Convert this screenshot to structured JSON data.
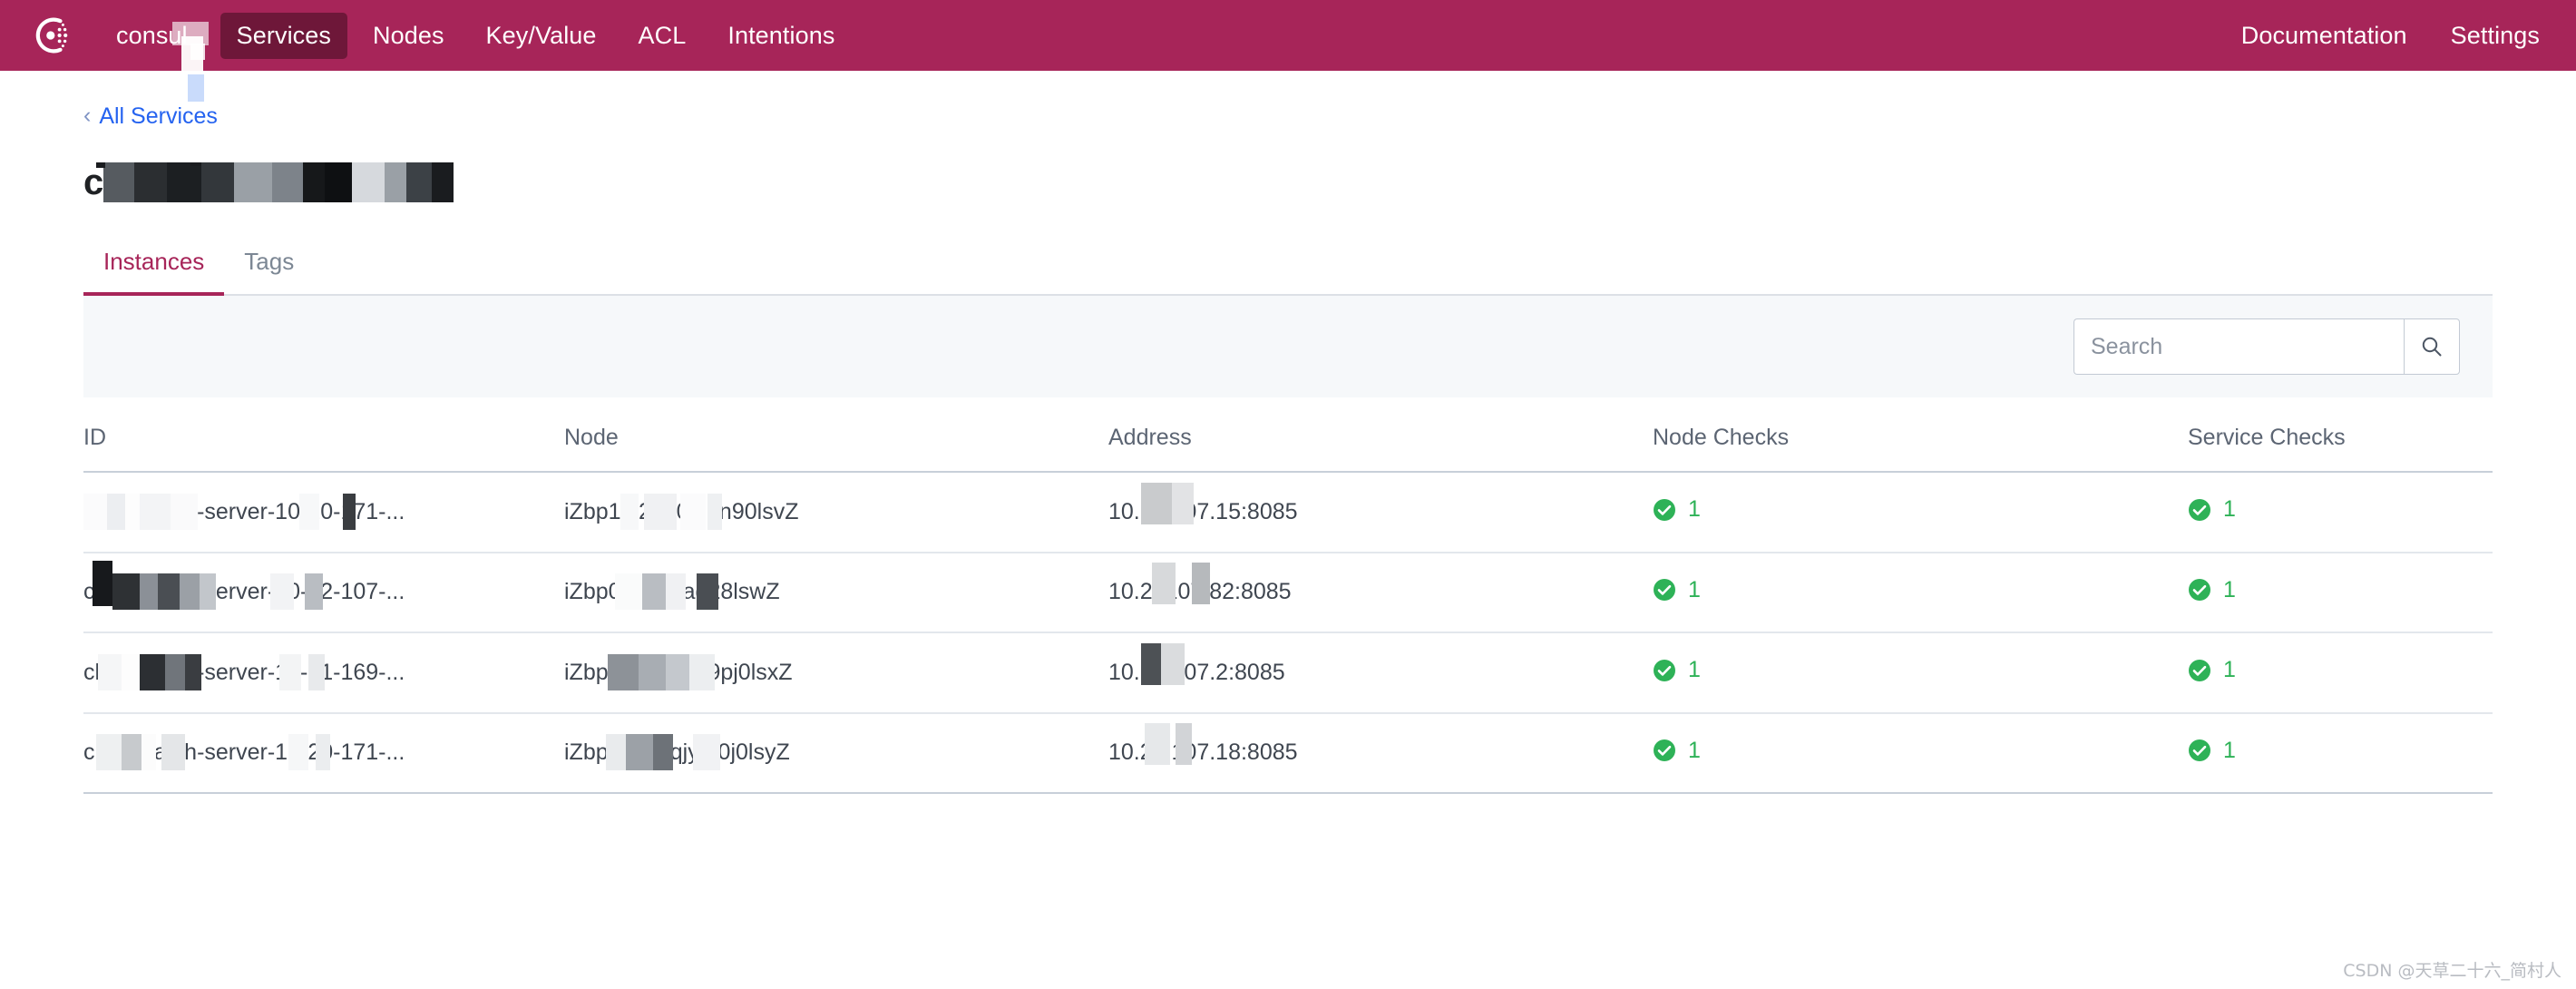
{
  "navbar": {
    "logo_icon": "consul-logo-icon",
    "brand": "consul",
    "items": [
      {
        "label": "Services",
        "active": true
      },
      {
        "label": "Nodes",
        "active": false
      },
      {
        "label": "Key/Value",
        "active": false
      },
      {
        "label": "ACL",
        "active": false
      },
      {
        "label": "Intentions",
        "active": false
      }
    ],
    "right_items": [
      {
        "label": "Documentation"
      },
      {
        "label": "Settings"
      }
    ],
    "background_color": "#a72559",
    "active_color": "#6e1739"
  },
  "breadcrumb": {
    "chevron_icon": "chevron-left-icon",
    "label": "All Services",
    "link_color": "#2563f0"
  },
  "page": {
    "title": "cloudwatch-server",
    "title_redacted": true
  },
  "tabs": [
    {
      "label": "Instances",
      "active": true
    },
    {
      "label": "Tags",
      "active": false
    }
  ],
  "toolbar": {
    "search": {
      "placeholder": "Search",
      "value": "",
      "button_icon": "search-icon"
    },
    "background_color": "#f6f8fa"
  },
  "table": {
    "columns": [
      "ID",
      "Node",
      "Address",
      "Node Checks",
      "Service Checks"
    ],
    "rows": [
      {
        "id": "cloudwatch-server-10-20-171-...",
        "node": "iZbp10i2mf0gi2n90lsvZ",
        "address": "10.20.107.15:8085",
        "node_checks": {
          "status": "passing",
          "count": "1",
          "icon": "check-circle-icon"
        },
        "service_checks": {
          "status": "passing",
          "count": "1",
          "icon": "check-circle-icon"
        }
      },
      {
        "id": "cloudwatch-server-10-22-107-...",
        "node": "iZbp0ugpkftag28lswZ",
        "address": "10.2 .107.82:8085",
        "node_checks": {
          "status": "passing",
          "count": "1",
          "icon": "check-circle-icon"
        },
        "service_checks": {
          "status": "passing",
          "count": "1",
          "icon": "check-circle-icon"
        }
      },
      {
        "id": "cloudwatch-server-10-21-169-...",
        "node": "iZbp1dfpqjtg4f9pj0lsxZ",
        "address": "10.21.107.2:8085",
        "node_checks": {
          "status": "passing",
          "count": "1",
          "icon": "check-circle-icon"
        },
        "service_checks": {
          "status": "passing",
          "count": "1",
          "icon": "check-circle-icon"
        }
      },
      {
        "id": "cloudwatch-server-10-20-171-...",
        "node": "iZbp1cnopqjytg0j0lsyZ",
        "address": "10.20.107.18:8085",
        "node_checks": {
          "status": "passing",
          "count": "1",
          "icon": "check-circle-icon"
        },
        "service_checks": {
          "status": "passing",
          "count": "1",
          "icon": "check-circle-icon"
        }
      }
    ],
    "status_color": "#2eb257"
  },
  "watermark": "CSDN @天草二十六_简村人"
}
